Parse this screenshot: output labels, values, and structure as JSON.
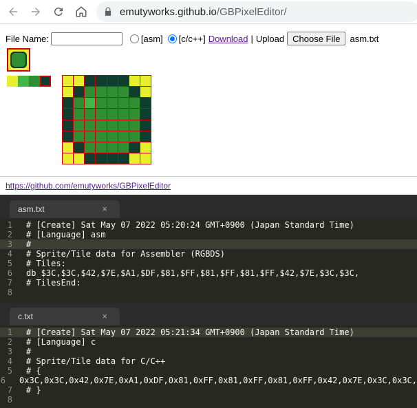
{
  "browser": {
    "url_host": "emutyworks.github.io",
    "url_path": "/GBPixelEditor/"
  },
  "form": {
    "file_name_label": "File Name:",
    "file_name_value": "",
    "radio_asm_label": "[asm]",
    "radio_c_label": "[c/c++]",
    "selected_format": "c/c++",
    "download_label": "Download",
    "separator": "|",
    "upload_label": "Upload",
    "choose_file_label": "Choose File",
    "chosen_file": "asm.txt"
  },
  "colors": {
    "lightest": "#e8ef2e",
    "light": "#41b845",
    "dark": "#2f8e33",
    "darkest": "#0f3d2e",
    "highlight": "#cc0000"
  },
  "palette": [
    "#e8ef2e",
    "#41b845",
    "#2f8e33",
    "#0f3d2e"
  ],
  "selected_palette_index": 3,
  "tile": [
    [
      0,
      0,
      3,
      3,
      3,
      3,
      0,
      0
    ],
    [
      0,
      3,
      2,
      2,
      2,
      2,
      3,
      0
    ],
    [
      3,
      2,
      1,
      2,
      2,
      2,
      2,
      3
    ],
    [
      3,
      2,
      2,
      2,
      2,
      2,
      2,
      3
    ],
    [
      3,
      2,
      2,
      2,
      2,
      2,
      2,
      3
    ],
    [
      3,
      2,
      2,
      2,
      2,
      2,
      2,
      3
    ],
    [
      0,
      3,
      2,
      2,
      2,
      2,
      3,
      0
    ],
    [
      0,
      0,
      3,
      3,
      3,
      3,
      0,
      0
    ]
  ],
  "repo_link": "https://github.com/emutyworks/GBPixelEditor",
  "editor_asm": {
    "tab_label": "asm.txt",
    "close_label": "×",
    "lines": [
      "# [Create] Sat May 07 2022 05:20:24 GMT+0900 (Japan Standard Time)",
      "# [Language] asm",
      "#",
      "# Sprite/Tile data for Assembler (RGBDS)",
      "# Tiles:",
      "db $3C,$3C,$42,$7E,$A1,$DF,$81,$FF,$81,$FF,$81,$FF,$42,$7E,$3C,$3C,",
      "# TilesEnd:",
      ""
    ],
    "active_line": 2
  },
  "editor_c": {
    "tab_label": "c.txt",
    "close_label": "×",
    "lines": [
      "# [Create] Sat May 07 2022 05:21:34 GMT+0900 (Japan Standard Time)",
      "# [Language] c",
      "#",
      "# Sprite/Tile data for C/C++",
      "# {",
      "0x3C,0x3C,0x42,0x7E,0xA1,0xDF,0x81,0xFF,0x81,0xFF,0x81,0xFF,0x42,0x7E,0x3C,0x3C,",
      "# }",
      ""
    ],
    "active_line": 0
  }
}
